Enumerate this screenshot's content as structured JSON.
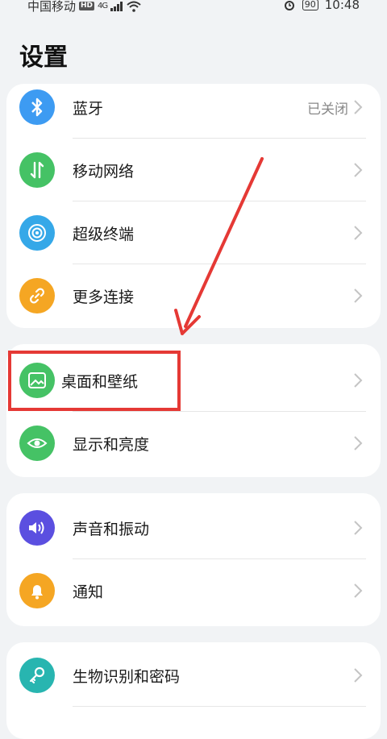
{
  "status_bar": {
    "carrier": "中国移动",
    "hd_badge": "HD",
    "network": "4G",
    "battery": "90",
    "time": "10:48"
  },
  "page_title": "设置",
  "groups": [
    {
      "items": [
        {
          "label": "蓝牙",
          "value": "已关闭",
          "icon": "bluetooth-icon",
          "color": "#3d9bf2"
        },
        {
          "label": "移动网络",
          "icon": "mobile-data-icon",
          "color": "#45c265"
        },
        {
          "label": "超级终端",
          "icon": "super-device-icon",
          "color": "#35a8e8"
        },
        {
          "label": "更多连接",
          "icon": "link-icon",
          "color": "#f5a623"
        }
      ]
    },
    {
      "items": [
        {
          "label": "桌面和壁纸",
          "icon": "wallpaper-icon",
          "color": "#45c265"
        },
        {
          "label": "显示和亮度",
          "icon": "eye-icon",
          "color": "#45c265"
        }
      ]
    },
    {
      "items": [
        {
          "label": "声音和振动",
          "icon": "speaker-icon",
          "color": "#5b4fe0"
        },
        {
          "label": "通知",
          "icon": "bell-icon",
          "color": "#f5a623"
        }
      ]
    },
    {
      "items": [
        {
          "label": "生物识别和密码",
          "icon": "key-icon",
          "color": "#28b5b0"
        }
      ]
    }
  ],
  "annotation_color": "#e53935"
}
